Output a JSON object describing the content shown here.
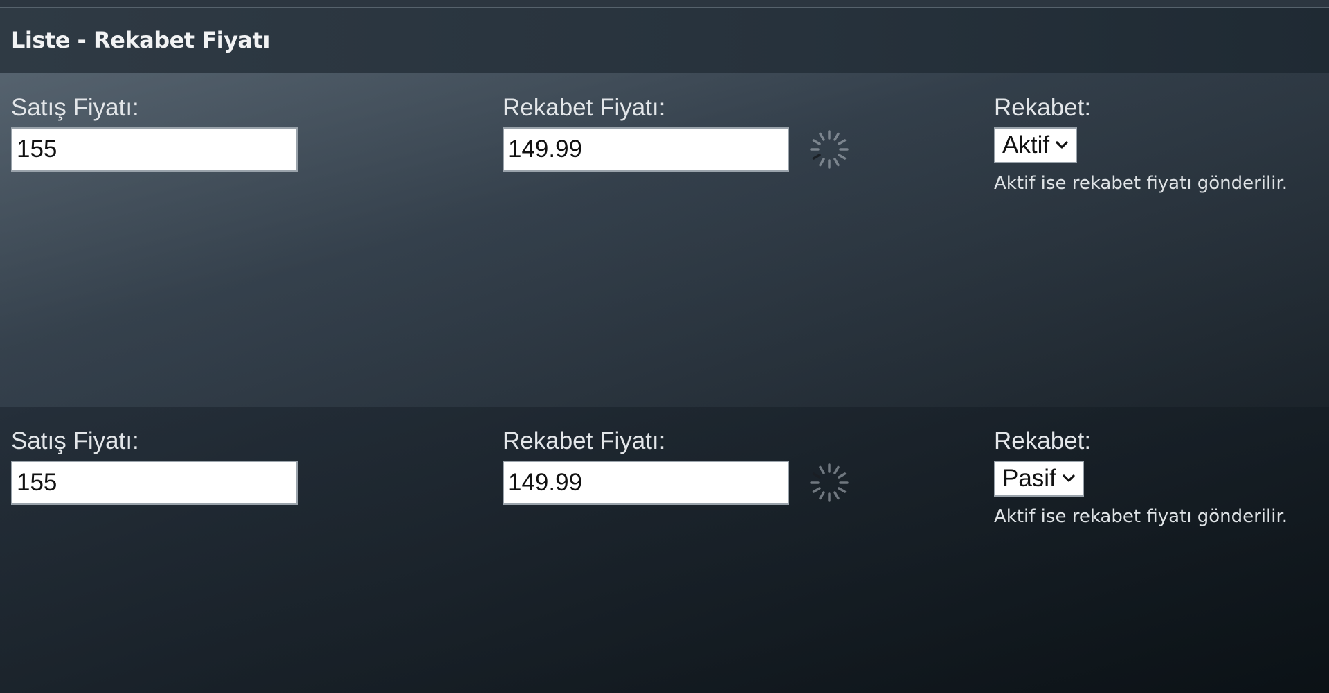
{
  "panel": {
    "title": "Liste - Rekabet Fiyatı"
  },
  "rows": [
    {
      "sale_price_label": "Satış Fiyatı:",
      "sale_price_value": "155",
      "competitor_price_label": "Rekabet Fiyatı:",
      "competitor_price_value": "149.99",
      "competition_label": "Rekabet:",
      "competition_selected": "Aktif",
      "competition_hint": "Aktif ise rekabet fiyatı gönderilir."
    },
    {
      "sale_price_label": "Satış Fiyatı:",
      "sale_price_value": "155",
      "competitor_price_label": "Rekabet Fiyatı:",
      "competitor_price_value": "149.99",
      "competition_label": "Rekabet:",
      "competition_selected": "Pasif",
      "competition_hint": "Aktif ise rekabet fiyatı gönderilir."
    }
  ],
  "icons": {
    "spinner": "loading-spinner-icon",
    "dropdown": "chevron-down-icon"
  }
}
